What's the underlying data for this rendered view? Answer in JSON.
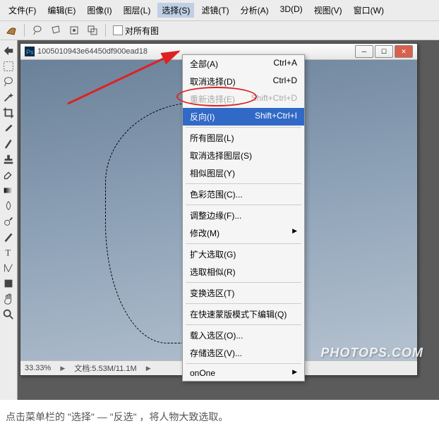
{
  "menu": {
    "items": [
      {
        "t": "文件(F)"
      },
      {
        "t": "编辑(E)"
      },
      {
        "t": "图像(I)"
      },
      {
        "t": "图层(L)"
      },
      {
        "t": "选择(S)",
        "active": true
      },
      {
        "t": "滤镜(T)"
      },
      {
        "t": "分析(A)"
      },
      {
        "t": "3D(D)"
      },
      {
        "t": "视图(V)"
      },
      {
        "t": "窗口(W)"
      }
    ]
  },
  "toolbar": {
    "checkbox": "对所有图"
  },
  "doc": {
    "title": "1005010943e64450df900ead18"
  },
  "status": {
    "zoom": "33.33%",
    "info": "文档:5.53M/11.1M"
  },
  "dropdown": {
    "items": [
      {
        "l": "全部(A)",
        "s": "Ctrl+A"
      },
      {
        "l": "取消选择(D)",
        "s": "Ctrl+D"
      },
      {
        "l": "重新选择(E)",
        "s": "Shift+Ctrl+D",
        "disabled": true
      },
      {
        "l": "反向(I)",
        "s": "Shift+Ctrl+I",
        "hl": true
      },
      {
        "sep": true
      },
      {
        "l": "所有图层(L)"
      },
      {
        "l": "取消选择图层(S)"
      },
      {
        "l": "相似图层(Y)"
      },
      {
        "sep": true
      },
      {
        "l": "色彩范围(C)..."
      },
      {
        "sep": true
      },
      {
        "l": "调整边缘(F)..."
      },
      {
        "l": "修改(M)",
        "sub": true
      },
      {
        "sep": true
      },
      {
        "l": "扩大选取(G)"
      },
      {
        "l": "选取相似(R)"
      },
      {
        "sep": true
      },
      {
        "l": "变换选区(T)"
      },
      {
        "sep": true
      },
      {
        "l": "在快速蒙版模式下编辑(Q)"
      },
      {
        "sep": true
      },
      {
        "l": "载入选区(O)..."
      },
      {
        "l": "存储选区(V)..."
      },
      {
        "sep": true
      },
      {
        "l": "onOne",
        "sub": true
      }
    ]
  },
  "caption": "点击菜单栏的 \"选择\" — \"反选\" ，将人物大致选取。",
  "watermark": "PHOTOPS.COM",
  "icons": {
    "lasso": "lasso",
    "wand": "wand",
    "crop": "crop",
    "eyedrop": "eyedrop",
    "brush": "brush",
    "stamp": "stamp",
    "eraser": "eraser",
    "gradient": "gradient",
    "blur": "blur",
    "dodge": "dodge",
    "pen": "pen",
    "text": "text",
    "path": "path",
    "shape": "shape",
    "hand": "hand",
    "zoom": "zoom",
    "move": "move",
    "marquee": "marquee"
  }
}
